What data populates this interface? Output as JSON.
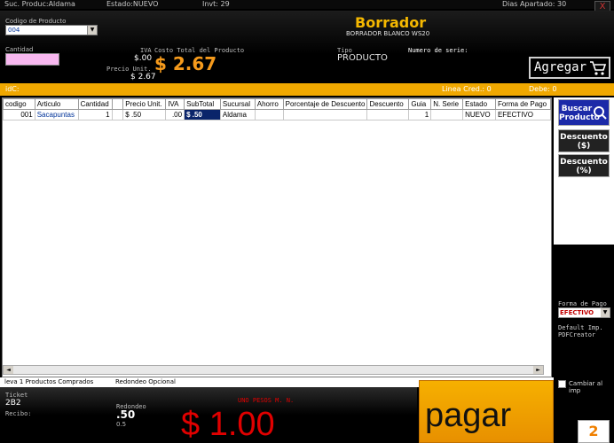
{
  "topbar": {
    "sucursal": "Suc. Produc:Aldama",
    "estado": "Estado:NUEVO",
    "invt": "Invt: 29",
    "dias_apartado": "Dias Apartado: 30",
    "close_label": "X"
  },
  "header": {
    "codigo_label": "Codigo de Producto",
    "codigo_value": "004",
    "cantidad_label": "Cantidad",
    "iva_label": "IVA",
    "iva_value": "$.00",
    "costo_total_label": "Costo Total del Producto",
    "costo_total_value": "$ 2.67",
    "precio_unit_label": "Precio Unit.",
    "precio_unit_value": "$ 2.67",
    "title": "Borrador",
    "subtitle": "BORRADOR BLANCO WS20",
    "tipo_label": "Tipo",
    "tipo_value": "PRODUCTO",
    "serie_label": "Numero de serie:",
    "agregar_label": "Agregar"
  },
  "orange_bar": {
    "idc": "idC:",
    "linea_cred": "Linea Cred.: 0",
    "debe": "Debe: 0"
  },
  "grid": {
    "columns": [
      "codigo",
      "Articulo",
      "Cantidad",
      "",
      "Precio Unit.",
      "IVA",
      "SubTotal",
      "Sucursal",
      "Ahorro",
      "Porcentaje de Descuento",
      "Descuento",
      "Guia",
      "N. Serie",
      "Estado",
      "Forma de Pago"
    ],
    "rows": [
      [
        "001",
        "Sacapuntas",
        "1",
        "",
        "$ .50",
        ".00",
        "$ .50",
        "Aldama",
        "",
        "",
        "",
        "1",
        "",
        "NUEVO",
        "EFECTIVO"
      ]
    ]
  },
  "right_panel": {
    "buscar_label": "Buscar Producto",
    "desc_pesos_label": "Descuento ($)",
    "desc_pct_label": "Descuento (%)",
    "forma_pago_label": "Forma de Pago",
    "forma_pago_value": "EFECTIVO",
    "default_imp_label": "Default Imp.",
    "default_imp_value": "PDFCreator",
    "cambiar_label": "Cambiar al imp",
    "count": "2"
  },
  "status": {
    "lleva": "leva 1 Productos Comprados",
    "redondeo_opcional": "Redondeo Opcional"
  },
  "bottom": {
    "ticket_label": "Ticket",
    "ticket_value": "2B2",
    "recibo_label": "Recibo:",
    "redondeo_label": "Redondeo",
    "redondeo_value": ".50",
    "redondeo_sub": "0.5",
    "amount_words": "UNO PESOS M. N.",
    "total": "$ 1.00",
    "pagar_label": "pagar"
  },
  "colors": {
    "accent_orange": "#f0a800",
    "price_orange": "#f59a1c",
    "total_red": "#e00000",
    "buscar_blue": "#1c2aa8"
  }
}
